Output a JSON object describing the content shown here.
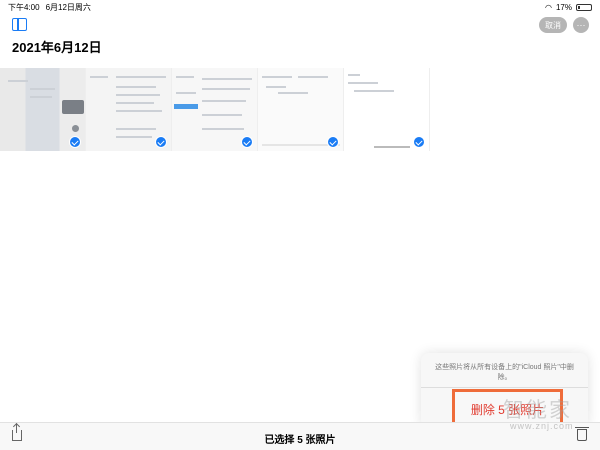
{
  "status_bar": {
    "time": "下午4:00",
    "date": "6月12日周六",
    "wifi_icon": "wifi-icon",
    "battery_percent": "17%",
    "battery_icon": "battery-icon"
  },
  "header": {
    "sidebar_icon": "sidebar-toggle-icon",
    "cancel_label": "取消",
    "more_label": "···",
    "date_title": "2021年6月12日"
  },
  "thumbnails": [
    {
      "selected": true
    },
    {
      "selected": true
    },
    {
      "selected": true
    },
    {
      "selected": true
    },
    {
      "selected": true
    }
  ],
  "popover": {
    "message": "这些照片将从所有设备上的\"iCloud 照片\"中删除。",
    "delete_label": "删除 5 张照片"
  },
  "toolbar": {
    "share_icon": "share-icon",
    "selected_text": "已选择 5 张照片",
    "trash_icon": "trash-icon"
  },
  "watermark": {
    "text": "智能家",
    "url": "www.znj.com"
  },
  "colors": {
    "accent": "#1a7cf5",
    "destructive": "#e13b2f",
    "highlight_box": "#ef6c3a"
  }
}
